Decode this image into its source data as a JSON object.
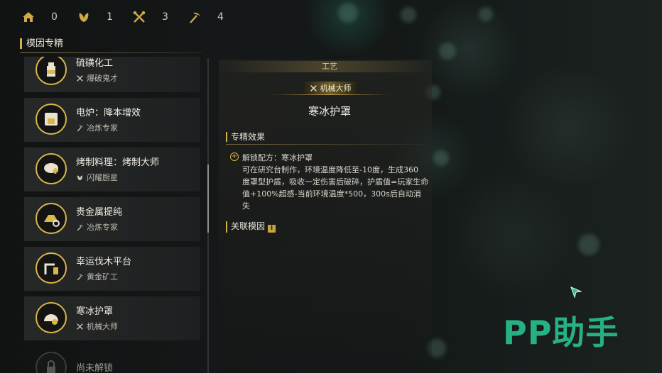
{
  "resources": [
    {
      "icon": "house-icon",
      "value": "0"
    },
    {
      "icon": "leaf-icon",
      "value": "1"
    },
    {
      "icon": "tools-icon",
      "value": "3"
    },
    {
      "icon": "pickaxe-icon",
      "value": "4"
    }
  ],
  "section_title": "模因专精",
  "list": [
    {
      "name": "硫磺化工",
      "sub_icon": "tools-icon",
      "sub": "爆破鬼才"
    },
    {
      "name": "电炉：降本增效",
      "sub_icon": "pickaxe-icon",
      "sub": "冶炼专家"
    },
    {
      "name": "烤制料理：烤制大师",
      "sub_icon": "leaf-icon",
      "sub": "闪耀厨星"
    },
    {
      "name": "贵金属提纯",
      "sub_icon": "pickaxe-icon",
      "sub": "冶炼专家"
    },
    {
      "name": "幸运伐木平台",
      "sub_icon": "pickaxe-icon",
      "sub": "黄金矿工"
    },
    {
      "name": "寒冰护罩",
      "sub_icon": "tools-icon",
      "sub": "机械大师"
    },
    {
      "name": "尚未解锁",
      "locked": true
    }
  ],
  "detail": {
    "category": "工艺",
    "badge": "机械大师",
    "title": "寒冰护罩",
    "effect_header": "专精效果",
    "effect_lines": [
      "解锁配方：寒冰护罩",
      "可在研究台制作，环境温度降低至-10度，生成360",
      "度罩型护盾，吸收一定伤害后破碎，护盾值=玩家生命",
      "值+100%超感-当前环境温度*500，300s后自动消",
      "失"
    ],
    "related_header": "关联模因",
    "related_info_icon": "i"
  },
  "watermark": "PP助手",
  "colors": {
    "accent": "#d2b24a",
    "watermark": "#27b98a"
  }
}
